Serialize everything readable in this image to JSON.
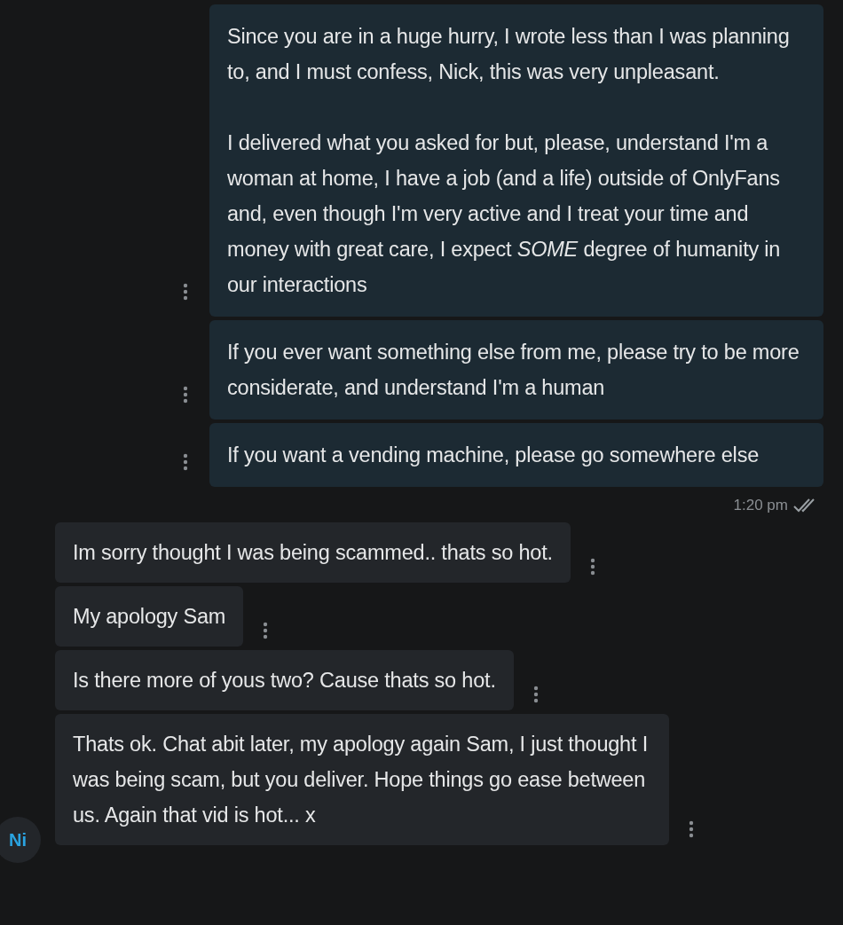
{
  "outgoing_messages": [
    {
      "text": "Since you are in a huge hurry, I wrote less than I was planning to, and I must confess, Nick, this was very unpleasant.\n\nI delivered what you asked for but, please, understand I'm a woman at home, I have a job (and a life) outside of OnlyFans and, even though I'm very active and I treat your time and money with great care, I expect *SOME* degree of humanity in our interactions"
    },
    {
      "text": "If you ever want something else from me, please try to be more considerate, and understand I'm a human"
    },
    {
      "text": "If you want a vending machine, please go somewhere else"
    }
  ],
  "outgoing_status": {
    "time": "1:20 pm",
    "read": true
  },
  "incoming_messages": [
    {
      "text": "Im sorry thought I was being scammed.. thats so hot."
    },
    {
      "text": "My apology Sam"
    },
    {
      "text": "Is there more of yous two? Cause thats so hot."
    },
    {
      "text": "Thats ok. Chat abit later, my apology again Sam, I just thought I was being scam, but you deliver. Hope things go ease between us. Again that vid is hot... x",
      "avatar": "Ni"
    }
  ]
}
